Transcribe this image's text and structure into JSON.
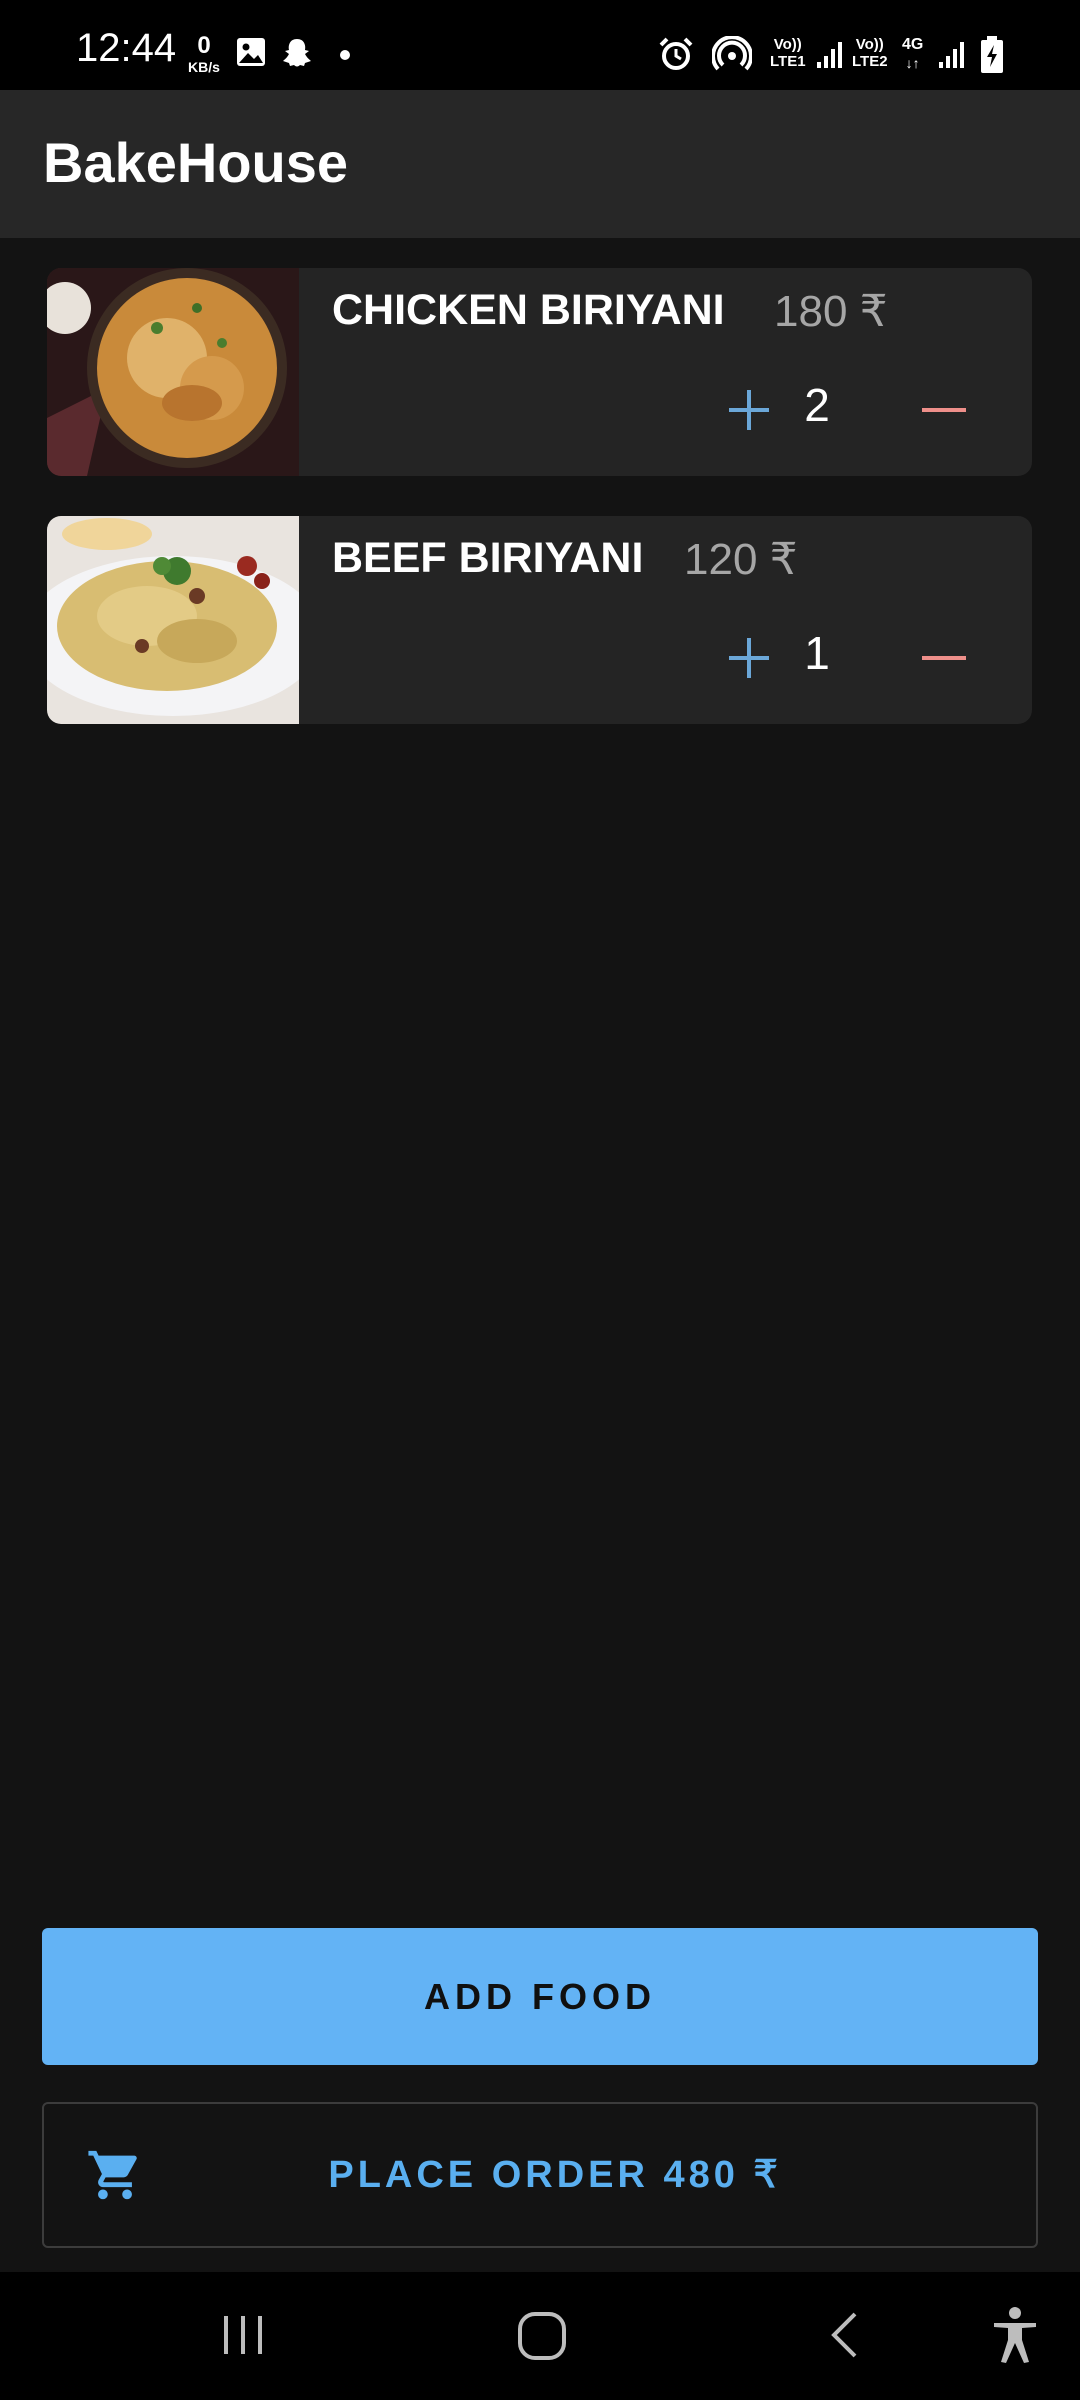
{
  "status_bar": {
    "time": "12:44",
    "data_speed_value": "0",
    "data_speed_unit": "KB/s",
    "sim1_label_top": "Vo))",
    "sim1_label_bottom": "LTE1",
    "sim2_label_top": "Vo))",
    "sim2_label_bottom": "LTE2",
    "network_type": "4G",
    "icons": [
      "gallery-icon",
      "snapchat-icon",
      "notification-dot",
      "alarm-icon",
      "hotspot-icon",
      "signal-icon",
      "battery-charging-icon"
    ]
  },
  "app_bar": {
    "title": "BakeHouse"
  },
  "cart": {
    "items": [
      {
        "name": "CHICKEN BIRIYANI",
        "price": "180 ₹",
        "quantity": "2",
        "image": "chicken-biriyani-photo"
      },
      {
        "name": "BEEF BIRIYANI",
        "price": "120 ₹",
        "quantity": "1",
        "image": "beef-biriyani-photo"
      }
    ]
  },
  "actions": {
    "add_food_label": "ADD FOOD",
    "place_order_label": "PLACE ORDER 480 ₹",
    "place_order_icon": "shopping-cart-icon"
  },
  "nav_bar": {
    "buttons": [
      "recents-icon",
      "home-icon",
      "back-icon",
      "accessibility-icon"
    ]
  },
  "colors": {
    "background": "#131313",
    "app_bar": "#272727",
    "card": "#242424",
    "primary": "#63b3f5",
    "plus": "#6ba7d8",
    "minus": "#ee8f8a"
  }
}
